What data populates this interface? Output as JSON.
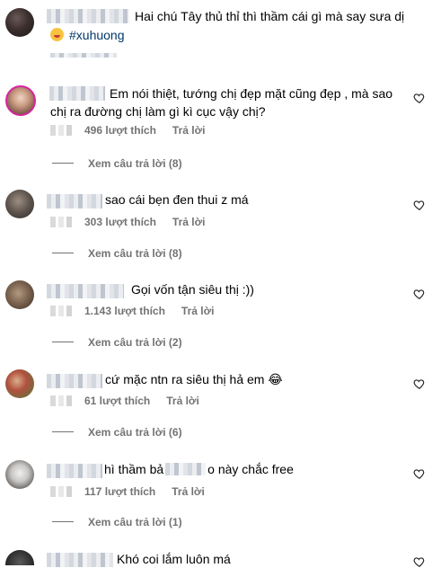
{
  "caption": {
    "text_line1": "Hai chú Tây thủ thỉ thì thầm cái gì mà say sưa dị",
    "hashtag": "#xuhuong"
  },
  "labels": {
    "like_suffix": "lượt thích",
    "reply": "Trả lời",
    "view_replies_prefix": "Xem câu trả lời"
  },
  "comments": [
    {
      "text": "Em nói thiệt, tướng chị đẹp mặt cũng đẹp , mà sao chị ra đường chị làm gì kì cục vậy chị?",
      "likes": "496 lượt thích",
      "reply": "Trả lời",
      "view_replies": "Xem câu trả lời (8)"
    },
    {
      "text": "sao cái bẹn đen thui z má",
      "likes": "303 lượt thích",
      "reply": "Trả lời",
      "view_replies": "Xem câu trả lời (8)"
    },
    {
      "text": "Gọi vốn tận siêu thị :))",
      "likes": "1.143 lượt thích",
      "reply": "Trả lời",
      "view_replies": "Xem câu trả lời (2)"
    },
    {
      "text": "cứ mặc ntn ra siêu thị hả em 😂",
      "likes": "61 lượt thích",
      "reply": "Trả lời",
      "view_replies": "Xem câu trả lời (6)"
    },
    {
      "text_a": "hì thầm bả",
      "text_b": "o này chắc free",
      "likes": "117 lượt thích",
      "reply": "Trả lời",
      "view_replies": "Xem câu trả lời (1)"
    },
    {
      "text": "Khó coi lắm luôn má"
    }
  ],
  "icons": {
    "heart": "heart-outline-icon"
  },
  "colors": {
    "text": "#000000",
    "muted": "#737373",
    "hashtag": "#00376b"
  }
}
